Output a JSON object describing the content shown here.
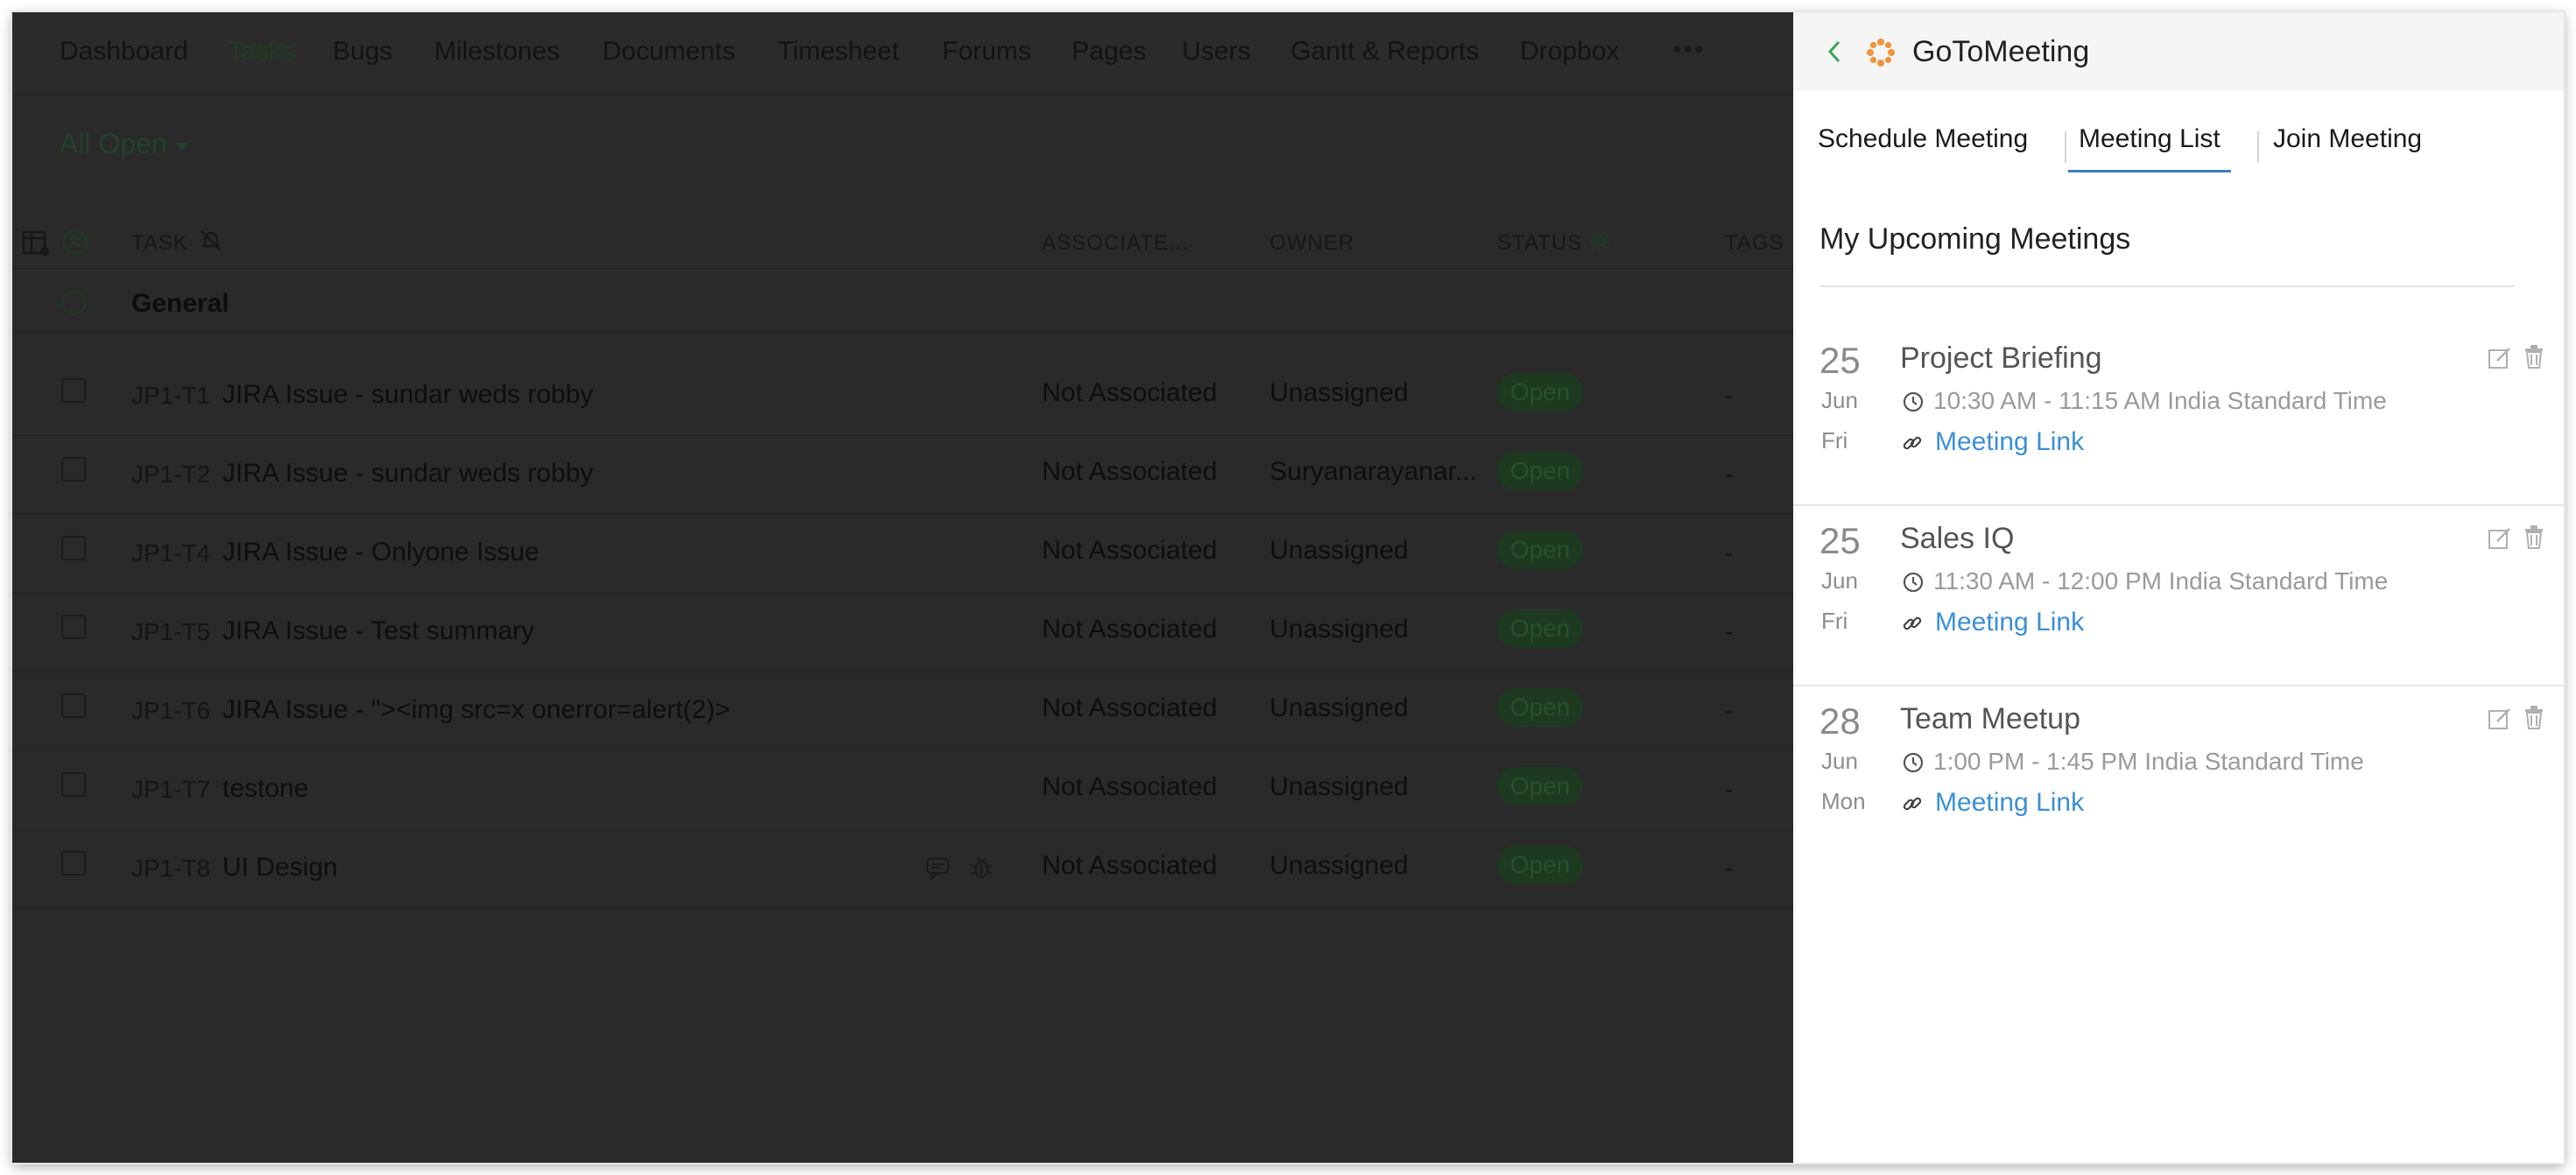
{
  "app": {
    "nav": [
      {
        "label": "Dashboard"
      },
      {
        "label": "Tasks"
      },
      {
        "label": "Bugs"
      },
      {
        "label": "Milestones"
      },
      {
        "label": "Documents"
      },
      {
        "label": "Timesheet"
      },
      {
        "label": "Forums"
      },
      {
        "label": "Pages"
      },
      {
        "label": "Users"
      },
      {
        "label": "Gantt & Reports"
      },
      {
        "label": "Dropbox"
      }
    ],
    "nav_more": "•••",
    "filter_label": "All Open",
    "columns": {
      "task": "TASK",
      "associated": "ASSOCIATE...",
      "owner": "OWNER",
      "status": "STATUS",
      "tags": "TAGS"
    },
    "group_label": "General",
    "rows": [
      {
        "id": "JP1-T1",
        "name": "JIRA Issue - sundar weds robby",
        "associated": "Not Associated",
        "owner": "Unassigned",
        "status": "Open",
        "tags": "-"
      },
      {
        "id": "JP1-T2",
        "name": "JIRA Issue - sundar weds robby",
        "associated": "Not Associated",
        "owner": "Suryanarayanar...",
        "status": "Open",
        "tags": "-"
      },
      {
        "id": "JP1-T4",
        "name": "JIRA Issue - Onlyone Issue",
        "associated": "Not Associated",
        "owner": "Unassigned",
        "status": "Open",
        "tags": "-"
      },
      {
        "id": "JP1-T5",
        "name": "JIRA Issue - Test summary",
        "associated": "Not Associated",
        "owner": "Unassigned",
        "status": "Open",
        "tags": "-"
      },
      {
        "id": "JP1-T6",
        "name": "JIRA Issue - \"><img src=x onerror=alert(2)>",
        "associated": "Not Associated",
        "owner": "Unassigned",
        "status": "Open",
        "tags": "-"
      },
      {
        "id": "JP1-T7",
        "name": "testone",
        "associated": "Not Associated",
        "owner": "Unassigned",
        "status": "Open",
        "tags": "-"
      },
      {
        "id": "JP1-T8",
        "name": "UI Design",
        "associated": "Not Associated",
        "owner": "Unassigned",
        "status": "Open",
        "tags": "-"
      }
    ]
  },
  "panel": {
    "title": "GoToMeeting",
    "tabs": [
      {
        "label": "Schedule Meeting"
      },
      {
        "label": "Meeting List"
      },
      {
        "label": "Join Meeting"
      }
    ],
    "active_tab": "Meeting List",
    "section_title": "My Upcoming Meetings",
    "meetings": [
      {
        "day": "25",
        "month": "Jun",
        "weekday": "Fri",
        "title": "Project Briefing",
        "time": "10:30 AM - 11:15 AM India Standard Time",
        "link_label": "Meeting Link"
      },
      {
        "day": "25",
        "month": "Jun",
        "weekday": "Fri",
        "title": "Sales IQ",
        "time": "11:30 AM - 12:00 PM India Standard Time",
        "link_label": "Meeting Link"
      },
      {
        "day": "28",
        "month": "Jun",
        "weekday": "Mon",
        "title": "Team Meetup",
        "time": "1:00 PM - 1:45 PM India Standard Time",
        "link_label": "Meeting Link"
      }
    ]
  },
  "colors": {
    "accent_blue": "#3a8fd8",
    "tab_underline": "#3c7fc0",
    "logo_orange": "#f0933a",
    "back_green": "#3aa35a"
  },
  "icons": {
    "back": "chevron-left-icon",
    "logo": "gotomeeting-logo-icon",
    "clock": "clock-icon",
    "link": "link-icon",
    "edit": "edit-icon",
    "trash": "trash-icon"
  }
}
